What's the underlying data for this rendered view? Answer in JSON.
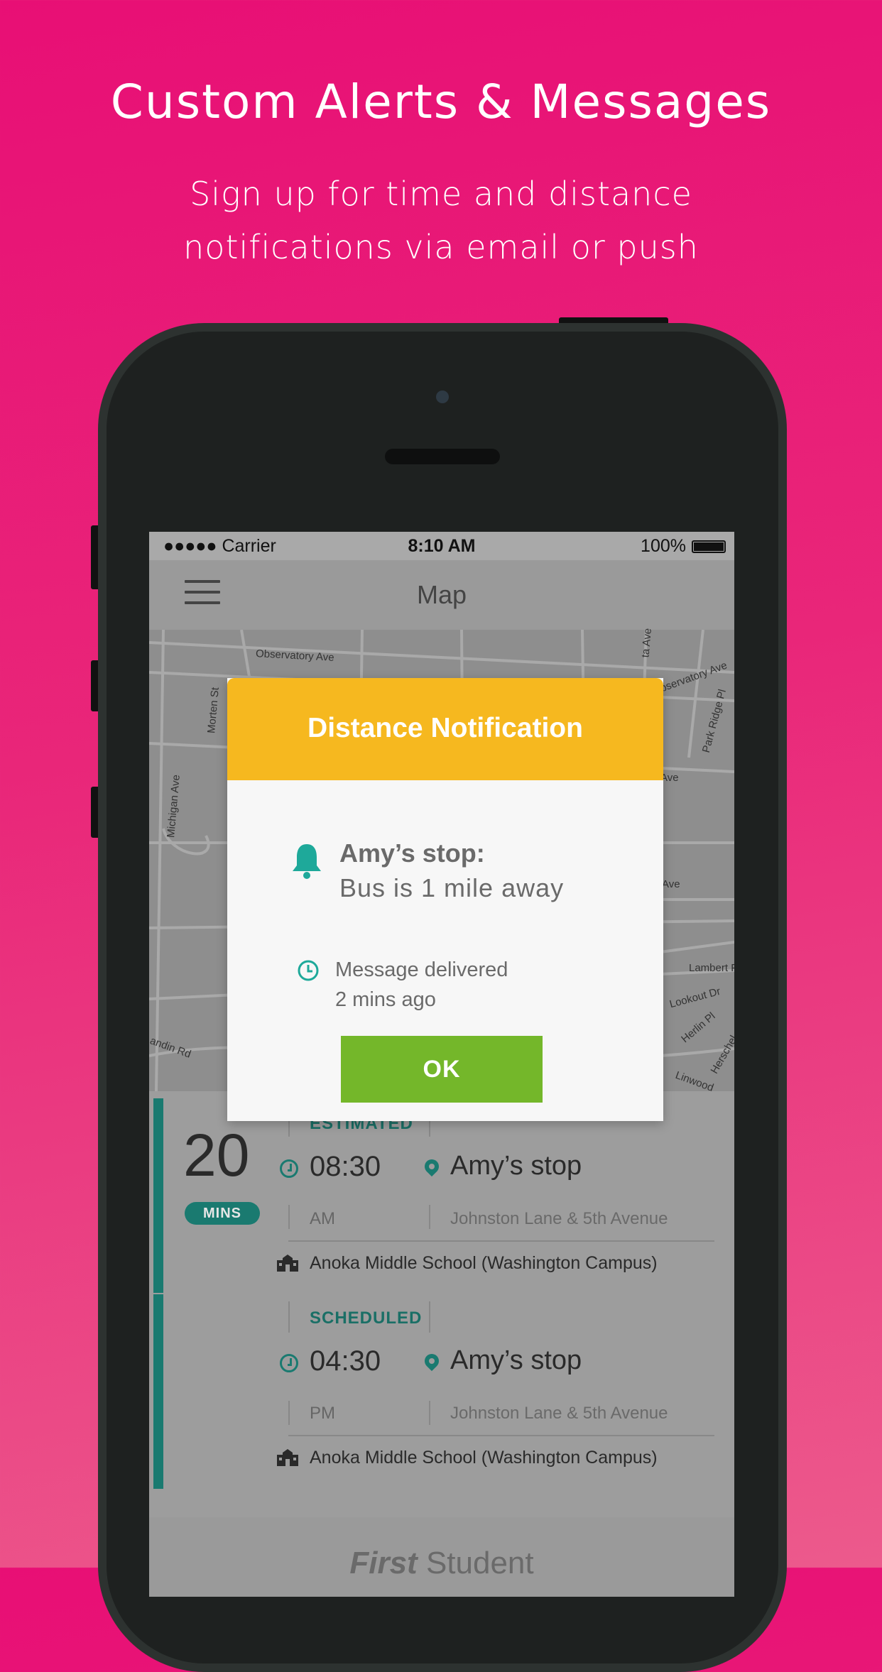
{
  "hero": {
    "title": "Custom Alerts & Messages",
    "subtitle_line1": "Sign up for time and distance",
    "subtitle_line2": "notifications via email or push"
  },
  "status_bar": {
    "carrier": "●●●●● Carrier",
    "time": "8:10 AM",
    "battery": "100%"
  },
  "nav": {
    "title": "Map"
  },
  "map": {
    "streets": [
      "Observatory Ave",
      "Morten St",
      "Michigan Ave",
      "Observatory Ave",
      "Park Ridge Pl",
      "Ave",
      "Ave",
      "Lambert Pl",
      "Lookout Dr",
      "Herlin Pl",
      "Herschel",
      "Linwood",
      "andin Rd",
      "ta Ave"
    ]
  },
  "cards": [
    {
      "mins": "20",
      "mins_label": "MINS",
      "status": "ESTIMATED",
      "time": "08:30",
      "ampm": "AM",
      "stop": "Amy’s stop",
      "address": "Johnston Lane & 5th Avenue",
      "school": "Anoka Middle School (Washington Campus)"
    },
    {
      "status": "SCHEDULED",
      "time": "04:30",
      "ampm": "PM",
      "stop": "Amy’s stop",
      "address": "Johnston Lane & 5th Avenue",
      "school": "Anoka Middle School (Washington Campus)"
    }
  ],
  "footer": {
    "brand_bold": "First",
    "brand_rest": " Student"
  },
  "modal": {
    "title": "Distance Notification",
    "stop": "Amy’s stop:",
    "message": "Bus is 1 mile away",
    "delivered_line1": "Message delivered",
    "delivered_line2": "2 mins ago",
    "ok_label": "OK"
  },
  "colors": {
    "background": "#e8187a",
    "modal_header": "#f6b81f",
    "ok_button": "#74b72a",
    "teal": "#1a7a70"
  },
  "icons": [
    "bell-icon",
    "clock-icon",
    "pin-icon",
    "school-icon",
    "menu-icon",
    "battery-icon"
  ]
}
